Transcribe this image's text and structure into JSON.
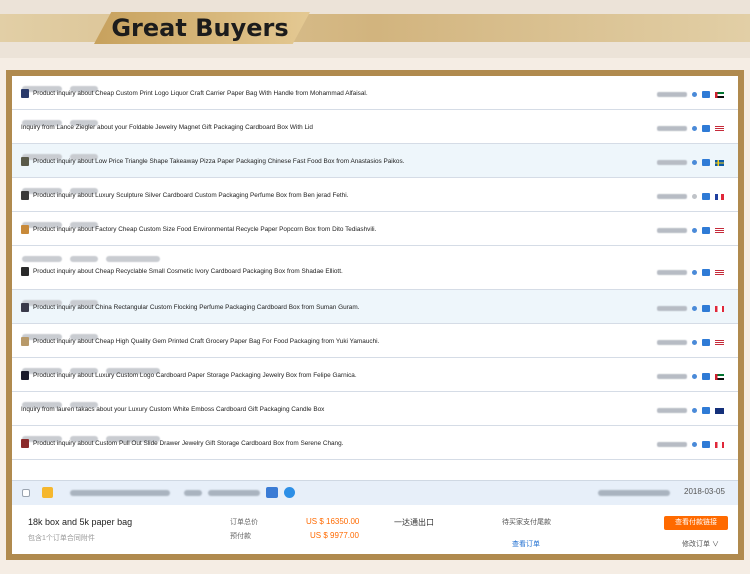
{
  "banner": {
    "title": "Great Buyers"
  },
  "inquiries": [
    {
      "text": "Product inquiry about Cheap Custom Print Logo Liquor Craft Carrier Paper Bag With Handle from Mohammad Alfaisal.",
      "thumb": true,
      "highlight": false,
      "flag": "ae",
      "thumb_color": "#2a3a6a"
    },
    {
      "text": "Inquiry from Lance Ziegler about your Foldable Jewelry Magnet Gift Packaging Cardboard Box With Lid",
      "thumb": false,
      "highlight": false,
      "flag": "us",
      "thumb_color": ""
    },
    {
      "text": "Product inquiry about Low Price Triangle Shape Takeaway Pizza Paper Packaging Chinese Fast Food Box from Anastasios Paikos.",
      "thumb": true,
      "highlight": true,
      "flag": "se",
      "thumb_color": "#5a5a4a"
    },
    {
      "text": "Product inquiry about Luxury Sculpture Silver Cardboard Custom Packaging Perfume Box from Ben jerad Fethi.",
      "thumb": true,
      "highlight": false,
      "flag": "fr",
      "thumb_color": "#3a3a3a"
    },
    {
      "text": "Product inquiry about Factory Cheap Custom Size Food Environmental Recycle Paper Popcorn Box from Dito Tediashvili.",
      "thumb": true,
      "highlight": false,
      "flag": "us",
      "thumb_color": "#c88a3a"
    },
    {
      "text": "Product inquiry about Cheap Recyclable Small Cosmetic Ivory Cardboard Packaging Box from Shadae Elliott.",
      "thumb": true,
      "highlight": false,
      "flag": "us",
      "thumb_color": "#2a2a2a"
    },
    {
      "text": "Product inquiry about China Rectangular Custom Flocking Perfume Packaging Cardboard Box from Suman Guram.",
      "thumb": true,
      "highlight": true,
      "flag": "ca",
      "thumb_color": "#3a3a4a"
    },
    {
      "text": "Product inquiry about Cheap High Quality Gem Printed Craft Grocery Paper Bag For Food Packaging from Yuki Yamauchi.",
      "thumb": true,
      "highlight": false,
      "flag": "us",
      "thumb_color": "#b89a6a"
    },
    {
      "text": "Product inquiry about Luxury Custom Logo Cardboard Paper Storage Packaging Jewelry Box from Felipe Garnica.",
      "thumb": true,
      "highlight": false,
      "flag": "ae",
      "thumb_color": "#1a1a2a"
    },
    {
      "text": "Inquiry from lauren takacs about your Luxury Custom White Emboss Cardboard Gift Packaging Candle Box",
      "thumb": false,
      "highlight": false,
      "flag": "au",
      "thumb_color": ""
    },
    {
      "text": "Product inquiry about Custom Pull Out Slide Drawer Jewelry Gift Storage Cardboard Box from Serene Chang.",
      "thumb": true,
      "highlight": false,
      "flag": "ca",
      "thumb_color": "#8a2a2a"
    }
  ],
  "order": {
    "date": "2018-03-05",
    "product": "18k box and 5k paper bag",
    "product_sub": "包含1个订单合同附件",
    "label_total": "订单总价",
    "label_prepay": "预付款",
    "price_total": "US $ 16350.00",
    "price_prepay": "US $ 9977.00",
    "ship": "一达通出口",
    "status": "待买家支付尾款",
    "view_link": "查看订单",
    "pay_button": "查看付款链接",
    "edit": "修改订单 ∨"
  },
  "colors": {
    "accent": "#b08a4e",
    "price": "#ff6a00",
    "highlight_row": "#eef6fb",
    "link": "#1f6fd1"
  }
}
